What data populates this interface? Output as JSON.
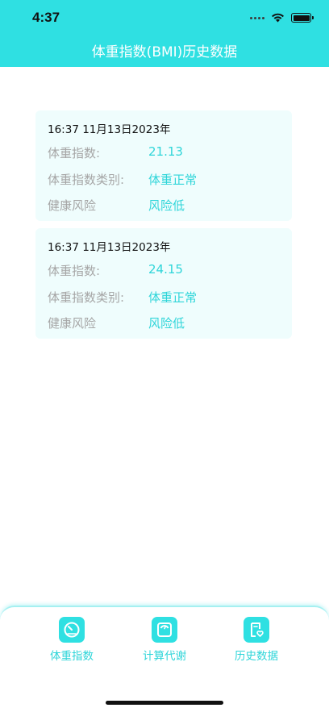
{
  "status_bar": {
    "time": "4:37"
  },
  "header": {
    "title": "体重指数(BMI)历史数据"
  },
  "records": [
    {
      "datetime": "16:37 11月13日2023年",
      "bmi_label": "体重指数:",
      "bmi_value": "21.13",
      "category_label": "体重指数类别:",
      "category_value": "体重正常",
      "risk_label": "健康风险",
      "risk_value": "风险低"
    },
    {
      "datetime": "16:37 11月13日2023年",
      "bmi_label": "体重指数:",
      "bmi_value": "24.15",
      "category_label": "体重指数类别:",
      "category_value": "体重正常",
      "risk_label": "健康风险",
      "risk_value": "风险低"
    }
  ],
  "tabbar": {
    "items": [
      {
        "label": "体重指数",
        "icon": "gauge-icon"
      },
      {
        "label": "计算代谢",
        "icon": "scale-icon"
      },
      {
        "label": "历史数据",
        "icon": "history-document-icon"
      }
    ]
  },
  "colors": {
    "accent": "#2fe0e2",
    "card_bg": "#effdfd",
    "label_gray": "#a6a6a6",
    "value_teal": "#2fd5d9"
  }
}
